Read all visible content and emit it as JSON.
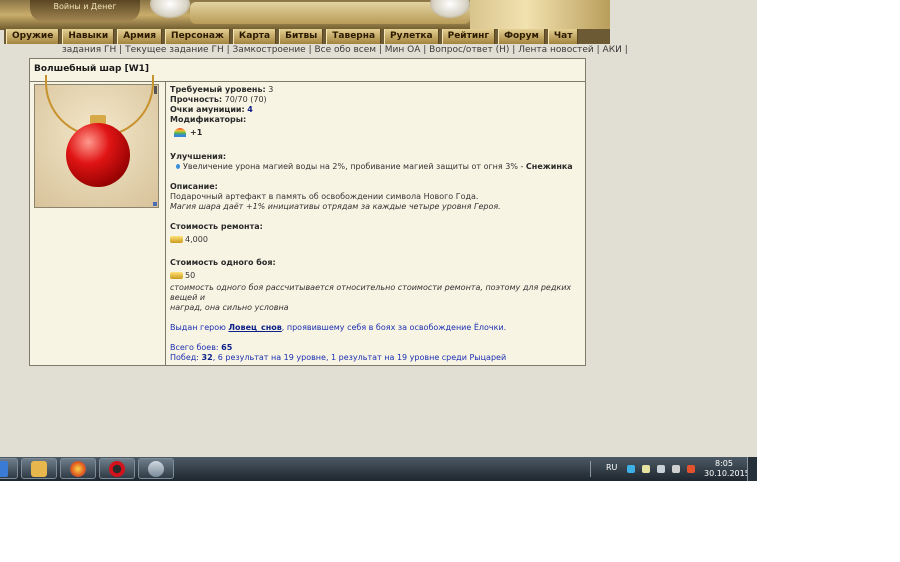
{
  "header": {
    "logo_text": "Войны и Денег"
  },
  "menu": [
    "Оружие",
    "Навыки",
    "Армия",
    "Персонаж",
    "Карта",
    "Битвы",
    "Таверна",
    "Рулетка",
    "Рейтинг",
    "Форум",
    "Чат"
  ],
  "links": [
    "задания ГН",
    "Текущее задание ГН",
    "Замкостроение",
    "Все обо всем",
    "Мин ОА",
    "Вопрос/ответ (Н)",
    "Лента новостей",
    "АКИ"
  ],
  "item": {
    "title": "Волшебный шар [W1]",
    "required_level_label": "Требуемый уровень:",
    "required_level_value": "3",
    "durability_label": "Прочность:",
    "durability_value": "70/70",
    "durability_max": "(70)",
    "ammo_label": "Очки амуниции:",
    "ammo_value": "4",
    "modifiers_label": "Модификаторы:",
    "modifier_value": "+1",
    "upgrades_label": "Улучшения:",
    "upgrade_text": "Увеличение урона магией воды на 2%, пробивание магией защиты от огня 3% -",
    "upgrade_name": "Снежинка",
    "description_label": "Описание:",
    "description_line1": "Подарочный артефакт в память об освобождении символа Нового Года.",
    "description_line2": "Магия шара даёт +1% инициативы отрядам за каждые четыре уровня Героя.",
    "repair_cost_label": "Стоимость ремонта:",
    "repair_cost_value": "4,000",
    "fight_cost_label": "Стоимость одного боя:",
    "fight_cost_value": "50",
    "fight_cost_note_line1": "стоимость одного боя рассчитывается относительно стоимости ремонта, поэтому для редких вещей и",
    "fight_cost_note_line2": "наград, она сильно условна",
    "issued_prefix": "Выдан герою",
    "issued_hero": "Ловец_снов",
    "issued_suffix": ", проявившему себя в боях за освобождение Ёлочки.",
    "total_fights_label": "Всего боев:",
    "total_fights_value": "65",
    "wins_label": "Побед:",
    "wins_value": "32",
    "wins_detail": ", 6 результат на 19 уровне, 1 результат на 19 уровне среди Рыцарей"
  },
  "taskbar": {
    "language": "RU",
    "time": "8:05",
    "date": "30.10.2015"
  }
}
